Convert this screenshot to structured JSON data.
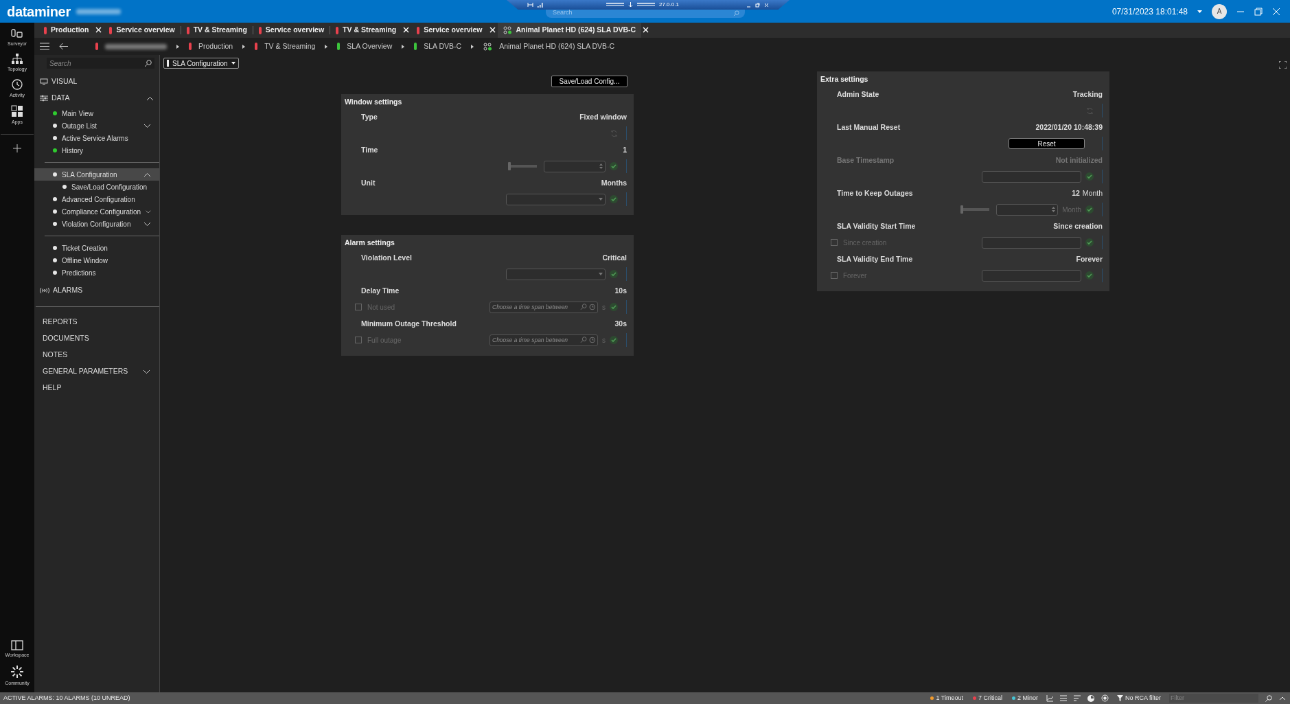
{
  "top_bar": {
    "logo": "dataminer",
    "remote_toolbar": {
      "address": "27.0.0.1",
      "search_placeholder": "Search"
    },
    "datetime": "07/31/2023 18:01:48",
    "avatar": "A"
  },
  "rail": {
    "top": [
      {
        "label": "Surveyor",
        "kind": "surveyor"
      },
      {
        "label": "Topology",
        "kind": "topology"
      },
      {
        "label": "Activity",
        "kind": "activity"
      },
      {
        "label": "Apps",
        "kind": "apps"
      }
    ],
    "bottom": [
      {
        "label": "Workspace",
        "kind": "workspace"
      },
      {
        "label": "Community",
        "kind": "community"
      }
    ]
  },
  "tabs": [
    {
      "label": "Production",
      "kind": "element",
      "color": "#e8414d",
      "closable": true,
      "selected": false
    },
    {
      "label": "Service overview",
      "kind": "element",
      "color": "#e8414d",
      "closable": false,
      "selected": false
    },
    {
      "label": "TV & Streaming",
      "kind": "element",
      "color": "#e8414d",
      "closable": false,
      "selected": false
    },
    {
      "label": "Service overview",
      "kind": "element",
      "color": "#e8414d",
      "closable": false,
      "selected": false
    },
    {
      "label": "TV & Streaming",
      "kind": "element",
      "color": "#e8414d",
      "closable": true,
      "selected": false
    },
    {
      "label": "Service overview",
      "kind": "element",
      "color": "#e8414d",
      "closable": true,
      "selected": false
    },
    {
      "label": "Animal Planet HD (624) SLA DVB-C",
      "kind": "service",
      "closable": true,
      "selected": true
    }
  ],
  "breadcrumb": [
    {
      "kind": "redacted",
      "color": "#e8414d"
    },
    {
      "label": "Production",
      "kind": "element",
      "color": "#e8414d"
    },
    {
      "label": "TV & Streaming",
      "kind": "element",
      "color": "#e8414d"
    },
    {
      "label": "SLA Overview",
      "kind": "element",
      "color": "#3cc43c"
    },
    {
      "label": "SLA DVB-C",
      "kind": "element",
      "color": "#3cc43c"
    },
    {
      "label": "Animal Planet HD (624) SLA DVB-C",
      "kind": "service"
    }
  ],
  "sidebar": {
    "search_placeholder": "Search",
    "sections": [
      {
        "label": "VISUAL",
        "kind": "visual"
      },
      {
        "label": "DATA",
        "kind": "data",
        "expanded": true,
        "groups": [
          [
            {
              "label": "Main View",
              "color": "#2fcb2f",
              "selected": false
            },
            {
              "label": "Outage List",
              "color": "#e6e6e6",
              "selected": false,
              "expanded": false
            },
            {
              "label": "Active Service Alarms",
              "color": "#e6e6e6",
              "selected": false
            },
            {
              "label": "History",
              "color": "#2fcb2f",
              "selected": false
            }
          ],
          [
            {
              "label": "SLA Configuration",
              "color": "#e6e6e6",
              "selected": true,
              "expanded": true,
              "children": [
                {
                  "label": "Save/Load Configuration",
                  "color": "#e6e6e6",
                  "selected": false
                }
              ]
            },
            {
              "label": "Advanced Configuration",
              "color": "#e6e6e6",
              "selected": false
            },
            {
              "label": "Compliance Configuration",
              "color": "#e6e6e6",
              "selected": false,
              "expanded": false
            },
            {
              "label": "Violation Configuration",
              "color": "#e6e6e6",
              "selected": false,
              "expanded": false
            }
          ],
          [
            {
              "label": "Ticket Creation",
              "color": "#e6e6e6",
              "selected": false
            },
            {
              "label": "Offline Window",
              "color": "#e6e6e6",
              "selected": false
            },
            {
              "label": "Predictions",
              "color": "#e6e6e6",
              "selected": false
            }
          ]
        ]
      },
      {
        "label": "ALARMS",
        "kind": "alarms"
      }
    ],
    "links": [
      {
        "label": "REPORTS"
      },
      {
        "label": "DOCUMENTS"
      },
      {
        "label": "NOTES"
      },
      {
        "label": "GENERAL PARAMETERS",
        "expanded": false
      },
      {
        "label": "HELP"
      }
    ]
  },
  "page_selector": "SLA Configuration",
  "save_load_button": "Save/Load Config...",
  "panels": [
    {
      "title": "Window settings",
      "rows": [
        {
          "label": "Type",
          "value": "Fixed window",
          "kind": "readonly",
          "disabled": false
        },
        {
          "label": "Time",
          "value": "1",
          "kind": "slider",
          "level": 0,
          "disabled": false
        },
        {
          "label": "Unit",
          "value": "Months",
          "kind": "dropdown",
          "disabled": false
        }
      ]
    },
    {
      "title": "Alarm settings",
      "rows": [
        {
          "label": "Violation Level",
          "value": "Critical",
          "kind": "dropdown",
          "disabled": false
        },
        {
          "label": "Delay Time",
          "value": "10s",
          "kind": "timespan",
          "checkbox": {
            "label": "Not used",
            "checked": false
          },
          "placeholder": "Choose a time span between",
          "unit": "s",
          "disabled": false
        },
        {
          "label": "Minimum Outage Threshold",
          "value": "30s",
          "kind": "timespan",
          "checkbox": {
            "label": "Full outage",
            "checked": false
          },
          "placeholder": "Choose a time span between",
          "unit": "s",
          "disabled": false
        }
      ]
    },
    {
      "title": "Extra settings",
      "rows": [
        {
          "label": "Admin State",
          "value": "Tracking",
          "kind": "readonly",
          "disabled": false
        },
        {
          "label": "Last Manual Reset",
          "value": "2022/01/20 10:48:39",
          "kind": "button",
          "button": "Reset",
          "disabled": false
        },
        {
          "label": "Base Timestamp",
          "value": "Not initialized",
          "kind": "text",
          "disabled": true
        },
        {
          "label": "Time to Keep Outages",
          "value": "12",
          "value_unit": "Month",
          "kind": "slider",
          "level": 0,
          "unit": "Month",
          "disabled": false
        },
        {
          "label": "SLA Validity Start Time",
          "value": "Since creation",
          "kind": "checktext",
          "checkbox": {
            "label": "Since creation",
            "checked": false
          },
          "disabled": false
        },
        {
          "label": "SLA Validity End Time",
          "value": "Forever",
          "kind": "checktext",
          "checkbox": {
            "label": "Forever",
            "checked": false
          },
          "disabled": false
        }
      ]
    }
  ],
  "status_bar": {
    "alarms": "ACTIVE ALARMS: 10 ALARMS (10 UNREAD)",
    "counters": [
      {
        "label": "1 Timeout",
        "color": "#f29b2c"
      },
      {
        "label": "7 Critical",
        "color": "#e8414d"
      },
      {
        "label": "2 Minor",
        "color": "#46c5d6"
      }
    ],
    "rca_filter": "No RCA filter",
    "filter_placeholder": "Filter"
  }
}
